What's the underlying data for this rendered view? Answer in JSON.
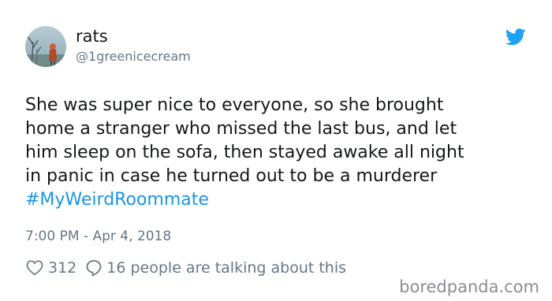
{
  "user": {
    "name": "rats",
    "handle": "@1greenicecream"
  },
  "tweet": {
    "lines": [
      "She was super nice to everyone, so she brought",
      "home a stranger who missed the last bus, and let",
      "him sleep on the sofa, then stayed awake all night",
      "in panic in case he turned out to be a murderer"
    ],
    "hashtag": "#MyWeirdRoommate",
    "timestamp": "7:00 PM - Apr 4, 2018"
  },
  "actions": {
    "like_count": "312",
    "reply_text": "16 people are talking about this"
  },
  "watermark": "boredpanda.com",
  "colors": {
    "link": "#1b95e0",
    "muted": "#657786",
    "text": "#14171a",
    "twitter_blue": "#1da1f2"
  },
  "icons": {
    "brand": "twitter-bird-icon",
    "like": "heart-icon",
    "reply": "speech-bubble-icon"
  }
}
